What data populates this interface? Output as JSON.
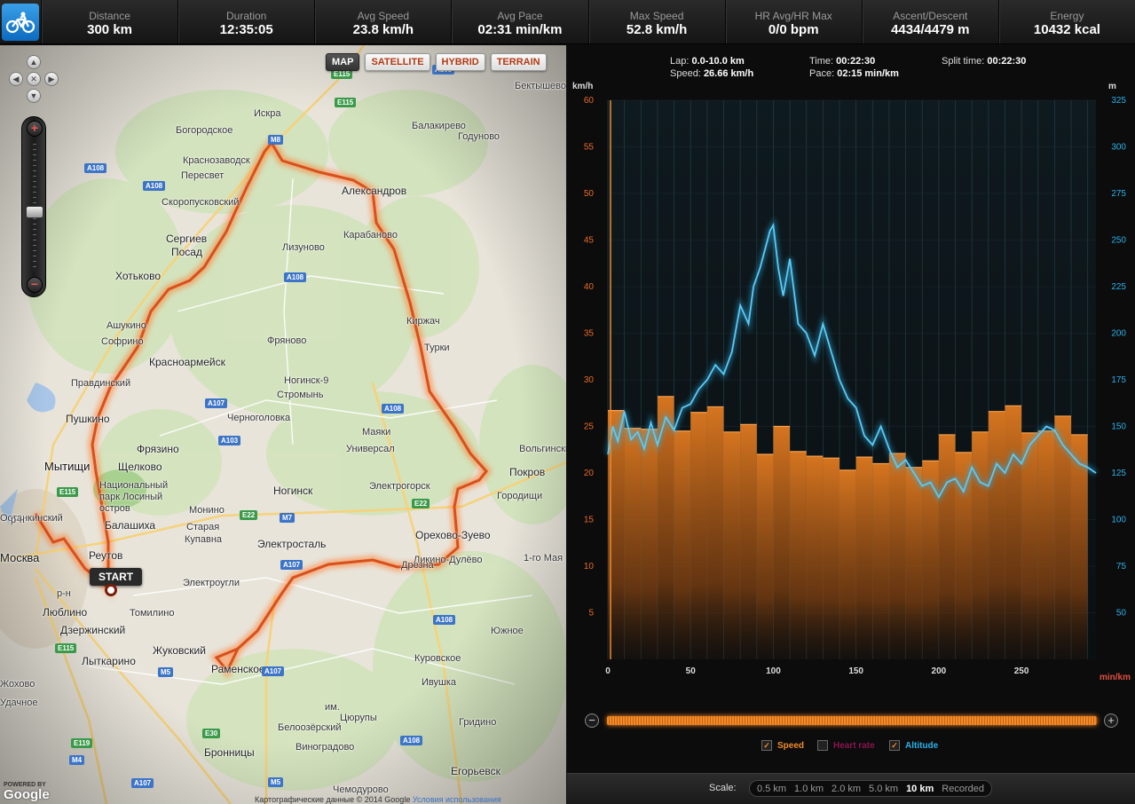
{
  "stats": [
    {
      "label": "Distance",
      "value": "300 km"
    },
    {
      "label": "Duration",
      "value": "12:35:05"
    },
    {
      "label": "Avg Speed",
      "value": "23.8 km/h"
    },
    {
      "label": "Avg Pace",
      "value": "02:31 min/km"
    },
    {
      "label": "Max Speed",
      "value": "52.8 km/h"
    },
    {
      "label": "HR Avg/HR Max",
      "value": "0/0 bpm"
    },
    {
      "label": "Ascent/Descent",
      "value": "4434/4479 m"
    },
    {
      "label": "Energy",
      "value": "10432 kcal"
    }
  ],
  "map": {
    "types": [
      "MAP",
      "SATELLITE",
      "HYBRID",
      "TERRAIN"
    ],
    "active_type": "MAP",
    "start_label": "START",
    "labels": [
      {
        "t": "Москва",
        "c": "big"
      },
      {
        "t": "Мытищи",
        "c": "big"
      },
      {
        "t": "Балашиха",
        "c": "city"
      },
      {
        "t": "Реутов",
        "c": "city"
      },
      {
        "t": "Люблино",
        "c": "city"
      },
      {
        "t": "Дзержинский",
        "c": "city"
      },
      {
        "t": "Лыткарино",
        "c": "city"
      },
      {
        "t": "Жуковский",
        "c": "city"
      },
      {
        "t": "Раменское",
        "c": "city"
      },
      {
        "t": "Бронницы",
        "c": "city"
      },
      {
        "t": "Томилино",
        "c": ""
      },
      {
        "t": "Электроугли",
        "c": ""
      },
      {
        "t": "Старая",
        "c": ""
      },
      {
        "t": "Купавна",
        "c": ""
      },
      {
        "t": "Монино",
        "c": ""
      },
      {
        "t": "Электросталь",
        "c": "city"
      },
      {
        "t": "Ногинск",
        "c": "city"
      },
      {
        "t": "Электрогорск",
        "c": ""
      },
      {
        "t": "Орехово-Зуево",
        "c": "city"
      },
      {
        "t": "Ликино-Дулёво",
        "c": ""
      },
      {
        "t": "Дрезна",
        "c": ""
      },
      {
        "t": "Покров",
        "c": "city"
      },
      {
        "t": "Городищи",
        "c": ""
      },
      {
        "t": "Вольгинский",
        "c": ""
      },
      {
        "t": "Щелково",
        "c": "city"
      },
      {
        "t": "Фрязино",
        "c": "city"
      },
      {
        "t": "Пушкино",
        "c": "city"
      },
      {
        "t": "Правдинский",
        "c": ""
      },
      {
        "t": "Красноармейск",
        "c": "city"
      },
      {
        "t": "Софрино",
        "c": ""
      },
      {
        "t": "Ашукино",
        "c": ""
      },
      {
        "t": "Хотьково",
        "c": "city"
      },
      {
        "t": "Сергиев",
        "c": "city"
      },
      {
        "t": "Посад",
        "c": "city"
      },
      {
        "t": "Скоропусковский",
        "c": ""
      },
      {
        "t": "Пересвет",
        "c": ""
      },
      {
        "t": "Краснозаводск",
        "c": ""
      },
      {
        "t": "Богородское",
        "c": ""
      },
      {
        "t": "Искра",
        "c": ""
      },
      {
        "t": "Балакирево",
        "c": ""
      },
      {
        "t": "Годуново",
        "c": ""
      },
      {
        "t": "Бектышево",
        "c": ""
      },
      {
        "t": "Александров",
        "c": "city"
      },
      {
        "t": "Карабаново",
        "c": ""
      },
      {
        "t": "Лизуново",
        "c": ""
      },
      {
        "t": "Киржач",
        "c": ""
      },
      {
        "t": "Турки",
        "c": ""
      },
      {
        "t": "Фряново",
        "c": ""
      },
      {
        "t": "Ногинск-9",
        "c": ""
      },
      {
        "t": "Стромынь",
        "c": ""
      },
      {
        "t": "Черноголовка",
        "c": ""
      },
      {
        "t": "Маяки",
        "c": ""
      },
      {
        "t": "Универсал",
        "c": ""
      },
      {
        "t": "Национальный",
        "c": ""
      },
      {
        "t": "парк Лосиный",
        "c": ""
      },
      {
        "t": "остров",
        "c": ""
      },
      {
        "t": "1-го Мая",
        "c": ""
      },
      {
        "t": "Южное",
        "c": ""
      },
      {
        "t": "Куровское",
        "c": ""
      },
      {
        "t": "Ивушка",
        "c": ""
      },
      {
        "t": "им.",
        "c": ""
      },
      {
        "t": "Цюрупы",
        "c": ""
      },
      {
        "t": "Белоозёрский",
        "c": ""
      },
      {
        "t": "Гридино",
        "c": ""
      },
      {
        "t": "Виноградово",
        "c": ""
      },
      {
        "t": "Егорьевск",
        "c": "city"
      },
      {
        "t": "Чемодурово",
        "c": ""
      },
      {
        "t": "Останкинский",
        "c": ""
      },
      {
        "t": "р-н",
        "c": ""
      },
      {
        "t": "р-н",
        "c": ""
      },
      {
        "t": "Жохово",
        "c": ""
      },
      {
        "t": "Удачное",
        "c": ""
      }
    ],
    "shields": [
      {
        "t": "E115",
        "c": "green"
      },
      {
        "t": "M8",
        "c": "blue"
      },
      {
        "t": "A108",
        "c": "blue"
      },
      {
        "t": "A108",
        "c": "blue"
      },
      {
        "t": "E115",
        "c": "green"
      },
      {
        "t": "A108",
        "c": "blue"
      },
      {
        "t": "A108",
        "c": "blue"
      },
      {
        "t": "A107",
        "c": "blue"
      },
      {
        "t": "A103",
        "c": "blue"
      },
      {
        "t": "E115",
        "c": "green"
      },
      {
        "t": "E22",
        "c": "green"
      },
      {
        "t": "M7",
        "c": "blue"
      },
      {
        "t": "E22",
        "c": "green"
      },
      {
        "t": "A107",
        "c": "blue"
      },
      {
        "t": "A108",
        "c": "blue"
      },
      {
        "t": "E115",
        "c": "green"
      },
      {
        "t": "M5",
        "c": "blue"
      },
      {
        "t": "A107",
        "c": "blue"
      },
      {
        "t": "E30",
        "c": "green"
      },
      {
        "t": "A108",
        "c": "blue"
      },
      {
        "t": "E119",
        "c": "green"
      },
      {
        "t": "M4",
        "c": "blue"
      },
      {
        "t": "A107",
        "c": "blue"
      },
      {
        "t": "M5",
        "c": "blue"
      },
      {
        "t": "A108",
        "c": "blue"
      }
    ],
    "attribution": "Картографические данные © 2014 Google",
    "terms_link": "Условия использования",
    "logo_text": "Google",
    "logo_caption": "POWERED BY"
  },
  "lap": {
    "lap_label": "Lap:",
    "lap_value": "0.0-10.0 km",
    "speed_label": "Speed:",
    "speed_value": "26.66 km/h",
    "time_label": "Time:",
    "time_value": "00:22:30",
    "pace_label": "Pace:",
    "pace_value": "02:15 min/km",
    "split_label": "Split time:",
    "split_value": "00:22:30"
  },
  "legend": [
    {
      "label": "Speed",
      "checked": true,
      "color": "#f08a2a"
    },
    {
      "label": "Heart rate",
      "checked": false,
      "color": "#8a1450"
    },
    {
      "label": "Altitude",
      "checked": true,
      "color": "#2ab0e8"
    }
  ],
  "scale": {
    "label": "Scale:",
    "options": [
      "0.5 km",
      "1.0 km",
      "2.0 km",
      "5.0 km",
      "10 km",
      "Recorded"
    ],
    "active": "10 km"
  },
  "colors": {
    "speed": "#f08a2a",
    "altitude": "#2ab0e8",
    "accent": "#f08a2a"
  },
  "chart_data": {
    "type": "bar",
    "xlabel": "min/km",
    "ylabel_left": "km/h",
    "ylabel_right": "m",
    "xticks": [
      0,
      50,
      100,
      150,
      200,
      250
    ],
    "xlim": [
      0,
      295
    ],
    "ylim_left": [
      0,
      60
    ],
    "yticks_left": [
      5,
      10,
      15,
      20,
      25,
      30,
      35,
      40,
      45,
      50,
      55,
      60
    ],
    "ylim_right": [
      25,
      325
    ],
    "yticks_right": [
      50,
      75,
      100,
      125,
      150,
      175,
      200,
      225,
      250,
      275,
      300,
      325
    ],
    "series": [
      {
        "name": "Speed",
        "bar_width_km": 10,
        "values": [
          26.7,
          24.8,
          24.7,
          28.2,
          24.5,
          26.5,
          27.1,
          24.4,
          25.2,
          22.0,
          25.0,
          22.3,
          21.8,
          21.6,
          20.3,
          21.7,
          21.0,
          22.1,
          20.6,
          21.3,
          24.1,
          22.2,
          24.4,
          26.6,
          27.2,
          24.3,
          24.5,
          26.1,
          24.1
        ],
        "x_start": 0
      },
      {
        "name": "Altitude",
        "x": [
          0,
          3,
          6,
          10,
          14,
          18,
          22,
          26,
          30,
          35,
          40,
          45,
          50,
          55,
          60,
          65,
          70,
          75,
          80,
          85,
          88,
          92,
          95,
          98,
          100,
          103,
          106,
          110,
          115,
          120,
          125,
          130,
          135,
          140,
          145,
          150,
          155,
          160,
          165,
          170,
          175,
          180,
          185,
          190,
          195,
          200,
          205,
          210,
          215,
          220,
          225,
          230,
          235,
          240,
          245,
          250,
          255,
          260,
          265,
          270,
          275,
          280,
          285,
          290,
          295
        ],
        "values": [
          135,
          150,
          142,
          158,
          143,
          147,
          138,
          152,
          140,
          155,
          148,
          160,
          162,
          170,
          175,
          183,
          178,
          190,
          215,
          205,
          225,
          235,
          245,
          255,
          258,
          235,
          220,
          240,
          205,
          200,
          188,
          205,
          190,
          175,
          165,
          160,
          145,
          140,
          150,
          138,
          128,
          132,
          125,
          118,
          120,
          112,
          120,
          122,
          115,
          128,
          120,
          118,
          130,
          125,
          135,
          130,
          140,
          145,
          150,
          148,
          140,
          135,
          130,
          128,
          125
        ]
      }
    ]
  }
}
